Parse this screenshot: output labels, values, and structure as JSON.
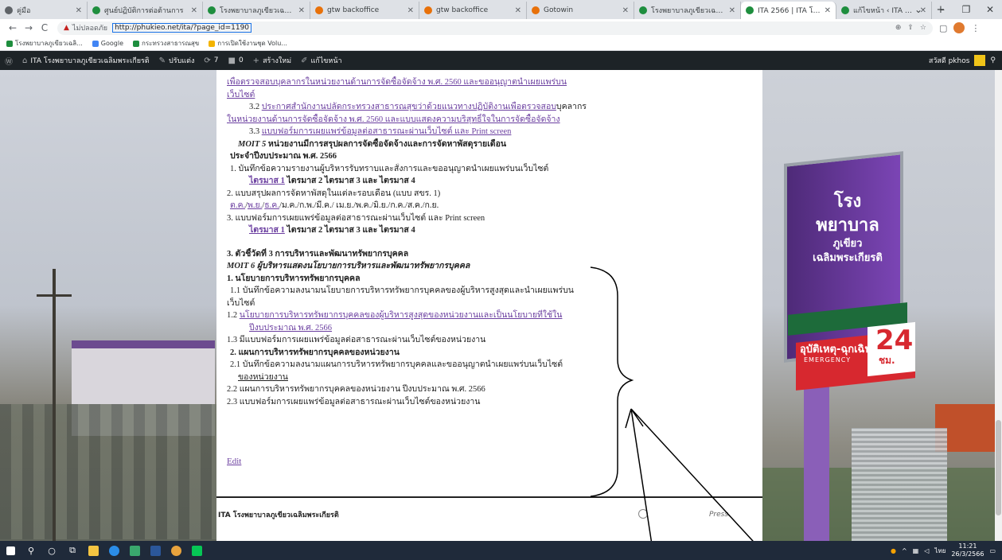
{
  "browser": {
    "tabs": [
      {
        "label": "คู่มือ",
        "color": "#5f6368",
        "active": false
      },
      {
        "label": "ศูนย์ปฏิบัติการต่อต้านการ",
        "color": "#1e8e3e",
        "active": false
      },
      {
        "label": "โรงพยาบาลภูเขียวเฉลิมพ",
        "color": "#1e8e3e",
        "active": false
      },
      {
        "label": "gtw backoffice",
        "color": "#e8710a",
        "active": false
      },
      {
        "label": "gtw backoffice",
        "color": "#e8710a",
        "active": false
      },
      {
        "label": "Gotowin",
        "color": "#e8710a",
        "active": false
      },
      {
        "label": "โรงพยาบาลภูเขียวเฉลิมพ",
        "color": "#1e8e3e",
        "active": false
      },
      {
        "label": "ITA 2566 | ITA โรงพยาบ",
        "color": "#1e8e3e",
        "active": true
      },
      {
        "label": "แก้ไขหน้า ‹ ITA โรงพยาบ",
        "color": "#1e8e3e",
        "active": false
      }
    ],
    "new_tab": "+",
    "window_controls": [
      "⌄",
      "–",
      "❐",
      "✕"
    ],
    "nav": {
      "back": "←",
      "forward": "→",
      "reload": "C"
    },
    "security_label": "ไม่ปลอดภัย",
    "url": "http://phukieo.net/ita/?page_id=1190",
    "bookmarks": [
      {
        "label": "โรงพยาบาลภูเขียวเฉลิ...",
        "color": "#1e8e3e"
      },
      {
        "label": "Google",
        "color": "#4285f4"
      },
      {
        "label": "กระทรวงสาธารณสุข",
        "color": "#1e8e3e"
      },
      {
        "label": "การเปิดใช้งานชุด Volu...",
        "color": "#f4b400"
      }
    ]
  },
  "adminbar": {
    "site": "ITA โรงพยาบาลภูเขียวเฉลิมพระเกียรติ",
    "customize": "ปรับแต่ง",
    "updates": "7",
    "comments": "0",
    "new": "สร้างใหม่",
    "edit_page": "แก้ไขหน้า",
    "greeting": "สวัสดี pkhos"
  },
  "article": {
    "l01": "เพื่อตรวจสอบบุคลากรในหน่วยงานด้านการจัดซื้อจัดจ้าง พ.ศ. 2560 และขออนุญาตนำเผยแพร่บน",
    "l02": "เว็บไซต์",
    "l03_num": "3.2 ",
    "l03": "ประกาศสำนักงานปลัดกระทรวงสาธารณสุขว่าด้วยแนวทางปฏิบัติงานเพื่อตรวจสอบ",
    "l03_tail": "บุคลากร",
    "l04": "ในหน่วยงานด้านการจัดซื้อจัดจ้าง พ.ศ. 2560 และแบบแสดงความบริสุทธิ์ใจในการจัดซื้อจัดจ้าง",
    "l05_num": "3.3 ",
    "l05": "แบบฟอร์มการเผยแพร่ข้อมูลต่อสาธารณะผ่านเว็บไซต์ และ Print screen",
    "l06_code": "MOIT 5",
    "l06": " หน่วยงานมีการสรุปผลการจัดซื้อจัดจ้างและการจัดหาพัสดุรายเดือน",
    "l07": "ประจำปีงบประมาณ พ.ศ. 2566",
    "l08": "1. บันทึกข้อความรายงานผู้บริหารรับทราบและสั่งการและขออนุญาตนำเผยแพร่บนเว็บไซต์",
    "l09_link": "ไตรมาส 1",
    "l09": " ไตรมาส 2 ไตรมาส 3 และ ไตรมาส 4",
    "l10": "2. แบบสรุปผลการจัดหาพัสดุในแต่ละรอบเดือน (แบบ สขร. 1)",
    "l11_link1": "ต.ค.",
    "l11_link2": "พ.ย.",
    "l11_link3": "ธ.ค.",
    "l11": "/ม.ค./ก.พ./มี.ค./ เม.ย./พ.ค./มิ.ย./ก.ค./ส.ค./ก.ย.",
    "l12": "3. แบบฟอร์มการเผยแพร่ข้อมูลต่อสาธารณะผ่านเว็บไซต์ และ Print screen",
    "l13_link": "ไตรมาส 1",
    "l13": " ไตรมาส 2 ไตรมาส 3 และ ไตรมาส 4",
    "l14": "3. ตัวชี้วัดที่ 3 การบริหารและพัฒนาทรัพยากรบุคคล",
    "l15": "MOIT 6 ผู้บริหารแสดงนโยบายการบริหารและพัฒนาทรัพยากรบุคคล",
    "l16": "1. นโยบายการบริหารทรัพยากรบุคคล",
    "l17": "1.1 บันทึกข้อความลงนามนโยบายการบริหารทรัพยากรบุคคลของผู้บริหารสูงสุดและนำเผยแพร่บน",
    "l18": "เว็บไซต์",
    "l19_num": "1.2 ",
    "l19": "นโยบายการบริหารทรัพยากรบุคคลของผู้บริหารสูงสุดของหน่วยงานและเป็นนโยบายที่ใช้ใน",
    "l20": "ปีงบประมาณ พ.ศ. 2566",
    "l21": "1.3 มีแบบฟอร์มการเผยแพร่ข้อมูลต่อสาธารณะผ่านเว็บไซต์ของหน่วยงาน",
    "l22": "2. แผนการบริหารทรัพยากรบุคคลของหน่วยงาน",
    "l23": "2.1 บันทึกข้อความลงนามแผนการบริหารทรัพยากรบุคคลและขออนุญาตนำเผยแพร่บนเว็บไซต์",
    "l24": "ของหน่วยงาน",
    "l25": "2.2 แผนการบริหารทรัพยากรบุคคลของหน่วยงาน ปีงบประมาณ พ.ศ. 2566",
    "l26": "2.3 แบบฟอร์มการเผยแพร่ข้อมูลต่อสาธารณะผ่านเว็บไซต์ของหน่วยงาน"
  },
  "edit_label": "Edit",
  "footer": {
    "site": "ITA โรงพยาบาลภูเขียวเฉลิมพระเกียรติ",
    "powered": "Press."
  },
  "background_sign": {
    "name_line1": "โรงพยาบาล",
    "name_line2": "ภูเขียวเฉลิมพระเกียรติ",
    "emergency_th": "อุบัติเหตุ-ฉุกเฉิน",
    "emergency_en": "EMERGENCY",
    "hours": "24",
    "hours_unit": "ชม."
  },
  "taskbar": {
    "clock_time": "11:21",
    "clock_date": "26/3/2566",
    "lang": "ไทย"
  },
  "colors": {
    "link": "#6b3fa0",
    "adminbar": "#1d2327",
    "annotation": "#000000"
  }
}
